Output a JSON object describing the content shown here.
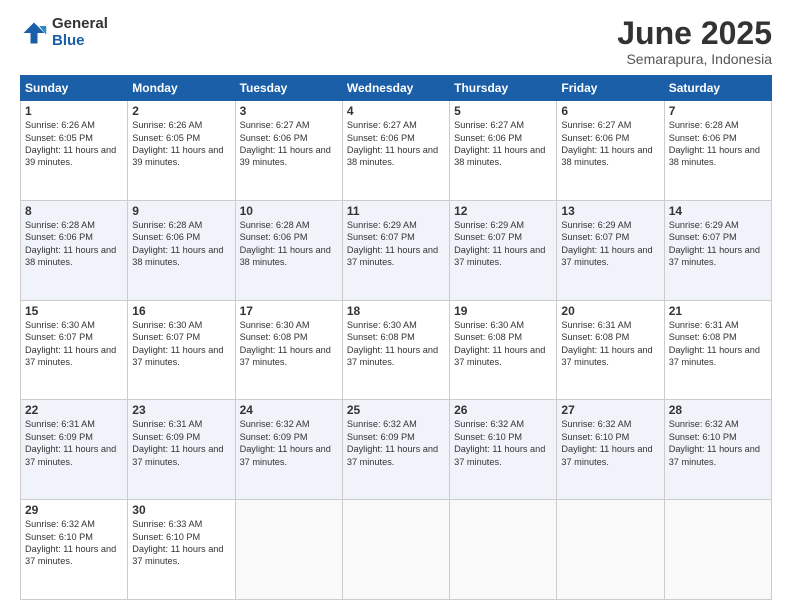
{
  "logo": {
    "general": "General",
    "blue": "Blue"
  },
  "header": {
    "month": "June 2025",
    "location": "Semarapura, Indonesia"
  },
  "weekdays": [
    "Sunday",
    "Monday",
    "Tuesday",
    "Wednesday",
    "Thursday",
    "Friday",
    "Saturday"
  ],
  "weeks": [
    [
      {
        "day": 1,
        "sunrise": "6:26 AM",
        "sunset": "6:05 PM",
        "daylight": "11 hours and 39 minutes."
      },
      {
        "day": 2,
        "sunrise": "6:26 AM",
        "sunset": "6:05 PM",
        "daylight": "11 hours and 39 minutes."
      },
      {
        "day": 3,
        "sunrise": "6:27 AM",
        "sunset": "6:06 PM",
        "daylight": "11 hours and 39 minutes."
      },
      {
        "day": 4,
        "sunrise": "6:27 AM",
        "sunset": "6:06 PM",
        "daylight": "11 hours and 38 minutes."
      },
      {
        "day": 5,
        "sunrise": "6:27 AM",
        "sunset": "6:06 PM",
        "daylight": "11 hours and 38 minutes."
      },
      {
        "day": 6,
        "sunrise": "6:27 AM",
        "sunset": "6:06 PM",
        "daylight": "11 hours and 38 minutes."
      },
      {
        "day": 7,
        "sunrise": "6:28 AM",
        "sunset": "6:06 PM",
        "daylight": "11 hours and 38 minutes."
      }
    ],
    [
      {
        "day": 8,
        "sunrise": "6:28 AM",
        "sunset": "6:06 PM",
        "daylight": "11 hours and 38 minutes."
      },
      {
        "day": 9,
        "sunrise": "6:28 AM",
        "sunset": "6:06 PM",
        "daylight": "11 hours and 38 minutes."
      },
      {
        "day": 10,
        "sunrise": "6:28 AM",
        "sunset": "6:06 PM",
        "daylight": "11 hours and 38 minutes."
      },
      {
        "day": 11,
        "sunrise": "6:29 AM",
        "sunset": "6:07 PM",
        "daylight": "11 hours and 37 minutes."
      },
      {
        "day": 12,
        "sunrise": "6:29 AM",
        "sunset": "6:07 PM",
        "daylight": "11 hours and 37 minutes."
      },
      {
        "day": 13,
        "sunrise": "6:29 AM",
        "sunset": "6:07 PM",
        "daylight": "11 hours and 37 minutes."
      },
      {
        "day": 14,
        "sunrise": "6:29 AM",
        "sunset": "6:07 PM",
        "daylight": "11 hours and 37 minutes."
      }
    ],
    [
      {
        "day": 15,
        "sunrise": "6:30 AM",
        "sunset": "6:07 PM",
        "daylight": "11 hours and 37 minutes."
      },
      {
        "day": 16,
        "sunrise": "6:30 AM",
        "sunset": "6:07 PM",
        "daylight": "11 hours and 37 minutes."
      },
      {
        "day": 17,
        "sunrise": "6:30 AM",
        "sunset": "6:08 PM",
        "daylight": "11 hours and 37 minutes."
      },
      {
        "day": 18,
        "sunrise": "6:30 AM",
        "sunset": "6:08 PM",
        "daylight": "11 hours and 37 minutes."
      },
      {
        "day": 19,
        "sunrise": "6:30 AM",
        "sunset": "6:08 PM",
        "daylight": "11 hours and 37 minutes."
      },
      {
        "day": 20,
        "sunrise": "6:31 AM",
        "sunset": "6:08 PM",
        "daylight": "11 hours and 37 minutes."
      },
      {
        "day": 21,
        "sunrise": "6:31 AM",
        "sunset": "6:08 PM",
        "daylight": "11 hours and 37 minutes."
      }
    ],
    [
      {
        "day": 22,
        "sunrise": "6:31 AM",
        "sunset": "6:09 PM",
        "daylight": "11 hours and 37 minutes."
      },
      {
        "day": 23,
        "sunrise": "6:31 AM",
        "sunset": "6:09 PM",
        "daylight": "11 hours and 37 minutes."
      },
      {
        "day": 24,
        "sunrise": "6:32 AM",
        "sunset": "6:09 PM",
        "daylight": "11 hours and 37 minutes."
      },
      {
        "day": 25,
        "sunrise": "6:32 AM",
        "sunset": "6:09 PM",
        "daylight": "11 hours and 37 minutes."
      },
      {
        "day": 26,
        "sunrise": "6:32 AM",
        "sunset": "6:10 PM",
        "daylight": "11 hours and 37 minutes."
      },
      {
        "day": 27,
        "sunrise": "6:32 AM",
        "sunset": "6:10 PM",
        "daylight": "11 hours and 37 minutes."
      },
      {
        "day": 28,
        "sunrise": "6:32 AM",
        "sunset": "6:10 PM",
        "daylight": "11 hours and 37 minutes."
      }
    ],
    [
      {
        "day": 29,
        "sunrise": "6:32 AM",
        "sunset": "6:10 PM",
        "daylight": "11 hours and 37 minutes."
      },
      {
        "day": 30,
        "sunrise": "6:33 AM",
        "sunset": "6:10 PM",
        "daylight": "11 hours and 37 minutes."
      },
      null,
      null,
      null,
      null,
      null
    ]
  ]
}
